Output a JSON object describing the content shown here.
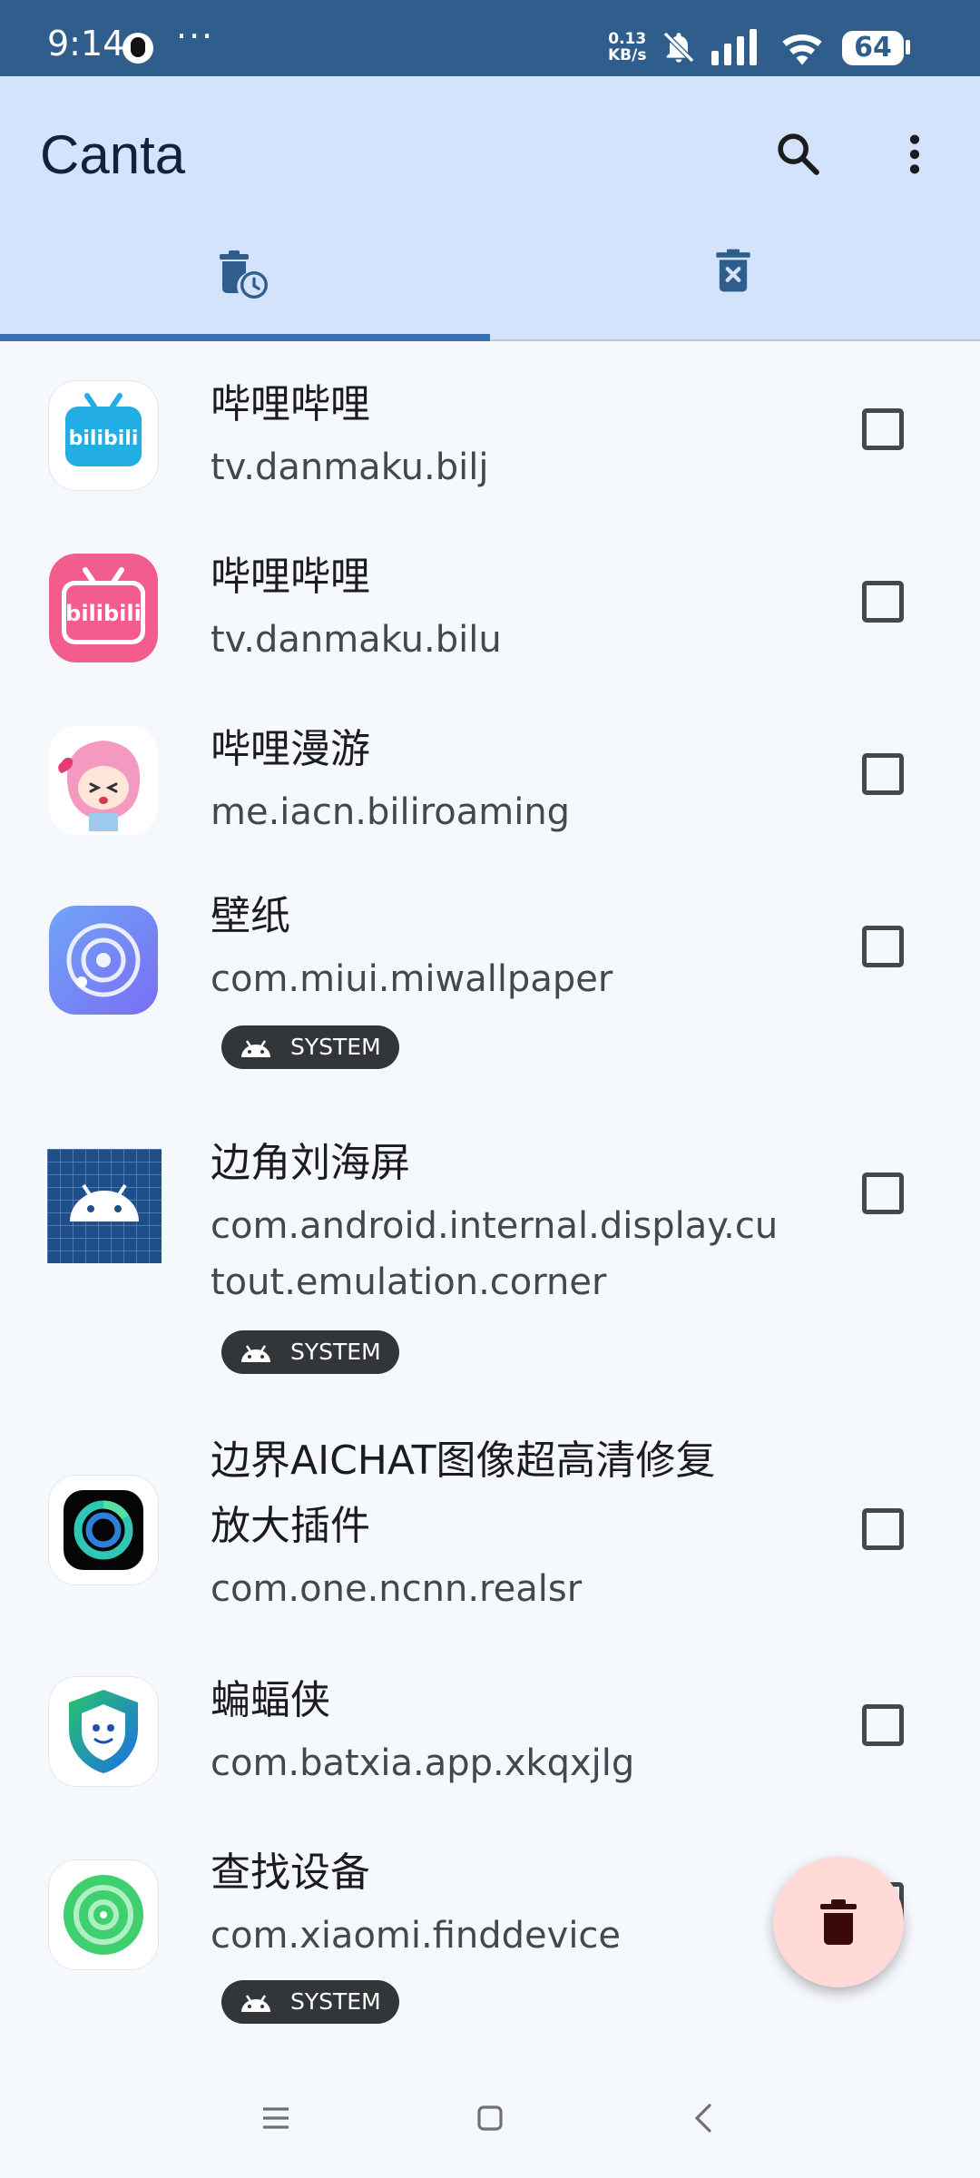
{
  "status_bar": {
    "time": "9:14",
    "more": "···",
    "net_speed_value": "0.13",
    "net_speed_unit": "KB/s",
    "battery": "64"
  },
  "app_bar": {
    "title": "Canta",
    "search_icon": "search-icon",
    "menu_icon": "more-vert-icon"
  },
  "tabs": [
    {
      "icon": "delete-clock-icon",
      "selected": true
    },
    {
      "icon": "delete-x-icon",
      "selected": false
    }
  ],
  "apps": [
    {
      "name": "哔哩哔哩",
      "package": "tv.danmaku.bilj",
      "icon": "bilibili-icon-blue",
      "system": false,
      "checked": false
    },
    {
      "name": "哔哩哔哩",
      "package": "tv.danmaku.bilu",
      "icon": "bilibili-icon-pink",
      "system": false,
      "checked": false
    },
    {
      "name": "哔哩漫游",
      "package": "me.iacn.biliroaming",
      "icon": "anime-girl-icon",
      "system": false,
      "checked": false
    },
    {
      "name": "壁纸",
      "package": "com.miui.miwallpaper",
      "icon": "wallpaper-icon",
      "system": true,
      "badge": "SYSTEM",
      "checked": false
    },
    {
      "name": "边角刘海屏",
      "package_line1": "com.android.internal.display.cu",
      "package_line2": "tout.emulation.corner",
      "icon": "android-grid-icon",
      "system": true,
      "badge": "SYSTEM",
      "checked": false
    },
    {
      "name_line1": "边界AICHAT图像超高清修复",
      "name_line2": "放大插件",
      "package": "com.one.ncnn.realsr",
      "icon": "aichat-icon",
      "system": false,
      "checked": false
    },
    {
      "name": "蝙蝠侠",
      "package": "com.batxia.app.xkqxjlg",
      "icon": "batxia-shield-icon",
      "system": false,
      "checked": false
    },
    {
      "name": "查找设备",
      "package": "com.xiaomi.finddevice",
      "icon": "find-device-icon",
      "system": true,
      "badge": "SYSTEM",
      "checked": false
    }
  ],
  "fab": {
    "icon": "delete-icon"
  },
  "colors": {
    "status_bar": "#2f5d8c",
    "app_bar": "#d3e3fb",
    "background": "#f5f8fd",
    "tab_indicator": "#3b6fb5",
    "fab": "#ffdad6",
    "badge": "#333639"
  }
}
